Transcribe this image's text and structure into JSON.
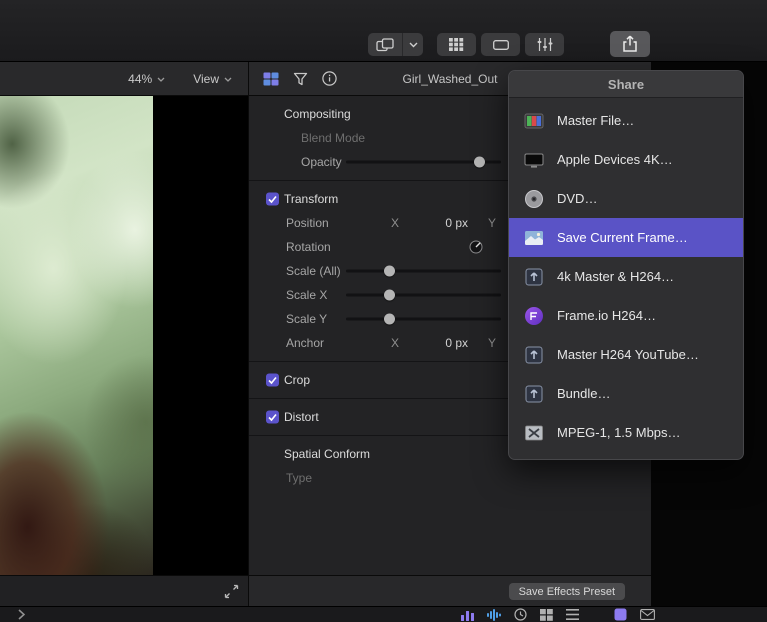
{
  "colors": {
    "accent": "#5a53c6",
    "checkbox": "#5b53cb",
    "panel_bg": "#232325",
    "selection_bg": "#5a53c6"
  },
  "toolbar": {
    "icons": [
      "overlap-squares-icon",
      "chevron-down-icon",
      "grid-view-icon",
      "filmstrip-view-icon",
      "adjust-sliders-icon",
      "share-icon"
    ]
  },
  "viewer": {
    "zoom_label": "44%",
    "view_label": "View"
  },
  "inspector_header": {
    "icons": [
      "video-inspector-icon",
      "filter-funnel-icon",
      "info-icon"
    ],
    "title": "Girl_Washed_Out"
  },
  "inspector": {
    "rows": [
      {
        "type": "section",
        "label": "Compositing"
      },
      {
        "type": "label",
        "label": "Blend Mode",
        "dim": true,
        "indent": 2
      },
      {
        "type": "slider",
        "label": "Opacity",
        "knob": 0.86,
        "indent": 2
      },
      {
        "type": "divider"
      },
      {
        "type": "section-check",
        "label": "Transform",
        "checked": true
      },
      {
        "type": "xy",
        "label": "Position",
        "x": "X",
        "value": "0 px",
        "y": "Y"
      },
      {
        "type": "dial",
        "label": "Rotation"
      },
      {
        "type": "slider",
        "label": "Scale (All)",
        "knob": 0.28
      },
      {
        "type": "slider",
        "label": "Scale X",
        "knob": 0.28
      },
      {
        "type": "slider",
        "label": "Scale Y",
        "knob": 0.28
      },
      {
        "type": "xy",
        "label": "Anchor",
        "x": "X",
        "value": "0 px",
        "y": "Y"
      },
      {
        "type": "divider"
      },
      {
        "type": "section-check",
        "label": "Crop",
        "checked": true
      },
      {
        "type": "divider"
      },
      {
        "type": "section-check",
        "label": "Distort",
        "checked": true
      },
      {
        "type": "divider"
      },
      {
        "type": "section",
        "label": "Spatial Conform"
      },
      {
        "type": "label",
        "label": "Type",
        "dim": true
      }
    ]
  },
  "share_menu": {
    "title": "Share",
    "items": [
      {
        "label": "Master File…",
        "icon": "master-file-icon"
      },
      {
        "label": "Apple Devices 4K…",
        "icon": "apple-devices-icon"
      },
      {
        "label": "DVD…",
        "icon": "dvd-icon"
      },
      {
        "label": "Save Current Frame…",
        "icon": "save-frame-icon",
        "selected": true
      },
      {
        "label": "4k Master & H264…",
        "icon": "export-box-icon"
      },
      {
        "label": "Frame.io H264…",
        "icon": "frameio-icon"
      },
      {
        "label": "Master H264 YouTube…",
        "icon": "export-box-icon"
      },
      {
        "label": "Bundle…",
        "icon": "export-box-icon"
      },
      {
        "label": "MPEG-1, 1.5 Mbps…",
        "icon": "mpeg-icon"
      }
    ]
  },
  "footer": {
    "save_preset_label": "Save Effects Preset"
  },
  "bottom_bar": {
    "icons": [
      "audio-meters-icon",
      "waveform-icon",
      "timer-icon",
      "index-grid-icon",
      "list-view-icon",
      "effects-icon",
      "mail-icon"
    ]
  }
}
